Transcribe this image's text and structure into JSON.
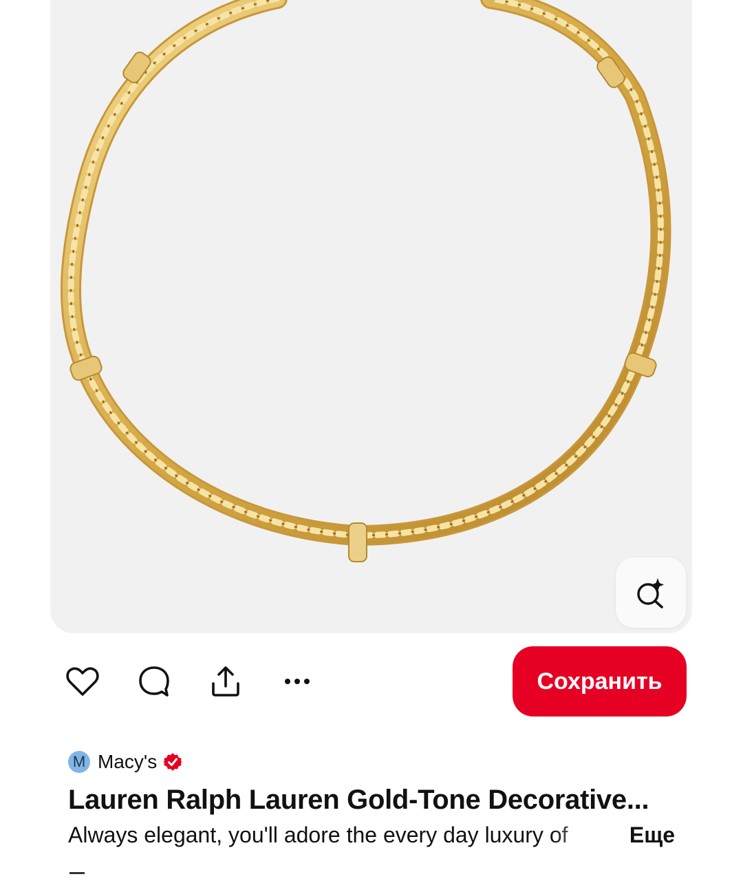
{
  "pin": {
    "image_alt": "Lauren Ralph Lauren Gold-Tone Decorative Necklace",
    "image_background": "#f1f1f1",
    "chain_color": "#d9b35a"
  },
  "visual_search": {
    "icon": "visual-search-sparkle-icon"
  },
  "actions": {
    "like_icon": "heart-icon",
    "comment_icon": "comment-icon",
    "share_icon": "share-icon",
    "more_icon": "more-horizontal-icon",
    "save_label": "Сохранить",
    "save_color": "#e60023"
  },
  "creator": {
    "avatar_letter": "M",
    "avatar_color": "#7fb6e6",
    "name": "Macy's",
    "verified_icon": "verified-check-icon",
    "verified_color": "#e60023"
  },
  "title": "Lauren Ralph Lauren Gold-Tone Decorative...",
  "description": "Always elegant, you'll adore the every day luxury of",
  "more_label": "Еще"
}
